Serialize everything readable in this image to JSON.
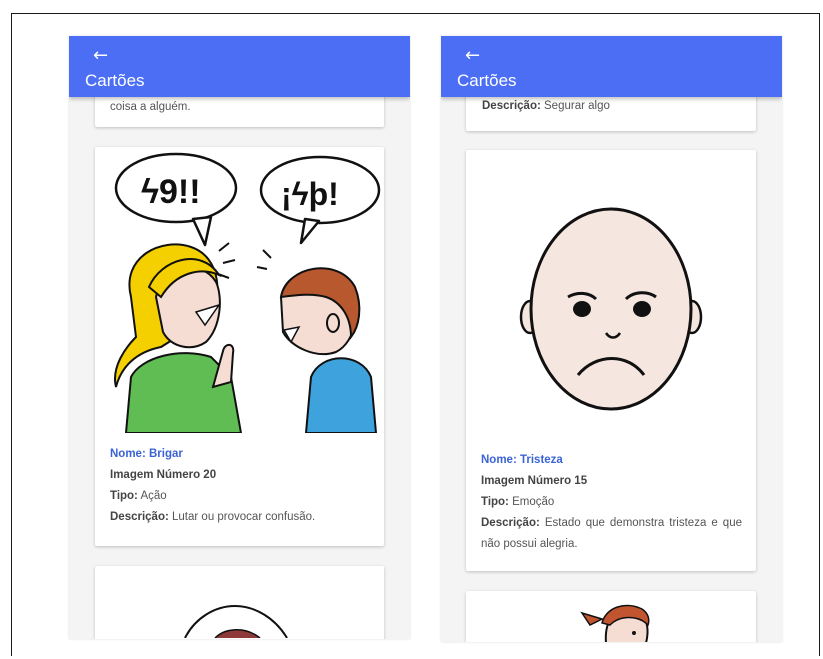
{
  "app": {
    "title": "Cartões",
    "back_icon": "arrow-left-icon",
    "accent": "#4c6ef5"
  },
  "left": {
    "top_card_fragment": "coisa a alguém.",
    "card": {
      "nome_label": "Nome:",
      "nome": "Brigar",
      "imagem": "Imagem Número 20",
      "tipo_label": "Tipo:",
      "tipo": "Ação",
      "descricao_label": "Descrição:",
      "descricao": "Lutar ou provocar confusão.",
      "speech_left": "ϟ9!!",
      "speech_right": "¡ϟþ!"
    }
  },
  "right": {
    "top_card_label": "Descrição:",
    "top_card_fragment": "Segurar algo",
    "card": {
      "nome_label": "Nome:",
      "nome": "Tristeza",
      "imagem": "Imagem Número 15",
      "tipo_label": "Tipo:",
      "tipo": "Emoção",
      "descricao_label": "Descrição:",
      "descricao": "Estado que demonstra tristeza e que não possui alegria."
    }
  }
}
